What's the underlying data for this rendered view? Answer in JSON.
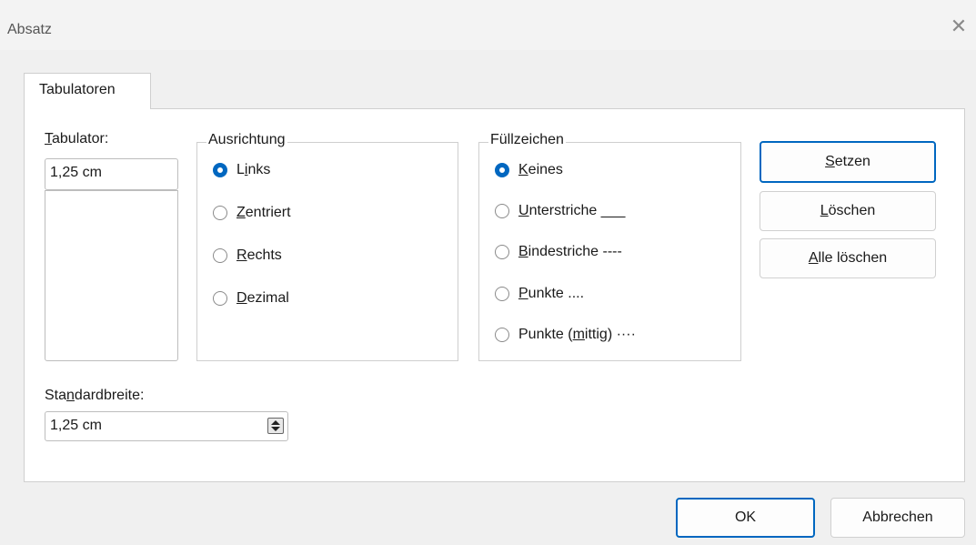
{
  "window": {
    "title": "Absatz",
    "close_icon": "close-icon"
  },
  "tabs": [
    {
      "label": "Tabulatoren",
      "active": true
    }
  ],
  "tabulator": {
    "label_mnemonic": "T",
    "label_rest": "abulator:",
    "value": "1,25 cm",
    "list_items": []
  },
  "ausrichtung": {
    "title": "Ausrichtung",
    "options": [
      {
        "mnemonic": "",
        "pre": "L",
        "u": "i",
        "post": "nks",
        "selected": true
      },
      {
        "pre": "",
        "u": "Z",
        "post": "entriert",
        "selected": false
      },
      {
        "pre": "",
        "u": "R",
        "post": "echts",
        "selected": false
      },
      {
        "pre": "",
        "u": "D",
        "post": "ezimal",
        "selected": false
      }
    ]
  },
  "fuellzeichen": {
    "title": "Füllzeichen",
    "options": [
      {
        "pre": "",
        "u": "K",
        "post": "eines",
        "selected": true
      },
      {
        "pre": "",
        "u": "U",
        "post": "nterstriche ___",
        "selected": false
      },
      {
        "pre": "",
        "u": "B",
        "post": "indestriche ----",
        "selected": false
      },
      {
        "pre": "",
        "u": "P",
        "post": "unkte ....",
        "selected": false
      },
      {
        "pre": "Punkte (",
        "u": "m",
        "post": "ittig) ····",
        "selected": false
      }
    ]
  },
  "buttons": {
    "setzen": {
      "pre": "",
      "u": "S",
      "post": "etzen"
    },
    "loeschen": {
      "pre": "",
      "u": "L",
      "post": "öschen"
    },
    "alle_loeschen": {
      "pre": "",
      "u": "A",
      "post": "lle löschen"
    },
    "ok": "OK",
    "abbrechen": "Abbrechen"
  },
  "standardbreite": {
    "pre": "Sta",
    "u": "n",
    "post": "dardbreite:",
    "value": "1,25 cm"
  },
  "colors": {
    "accent": "#0067c0",
    "panel": "#ffffff",
    "dialog": "#f0f0f0"
  }
}
